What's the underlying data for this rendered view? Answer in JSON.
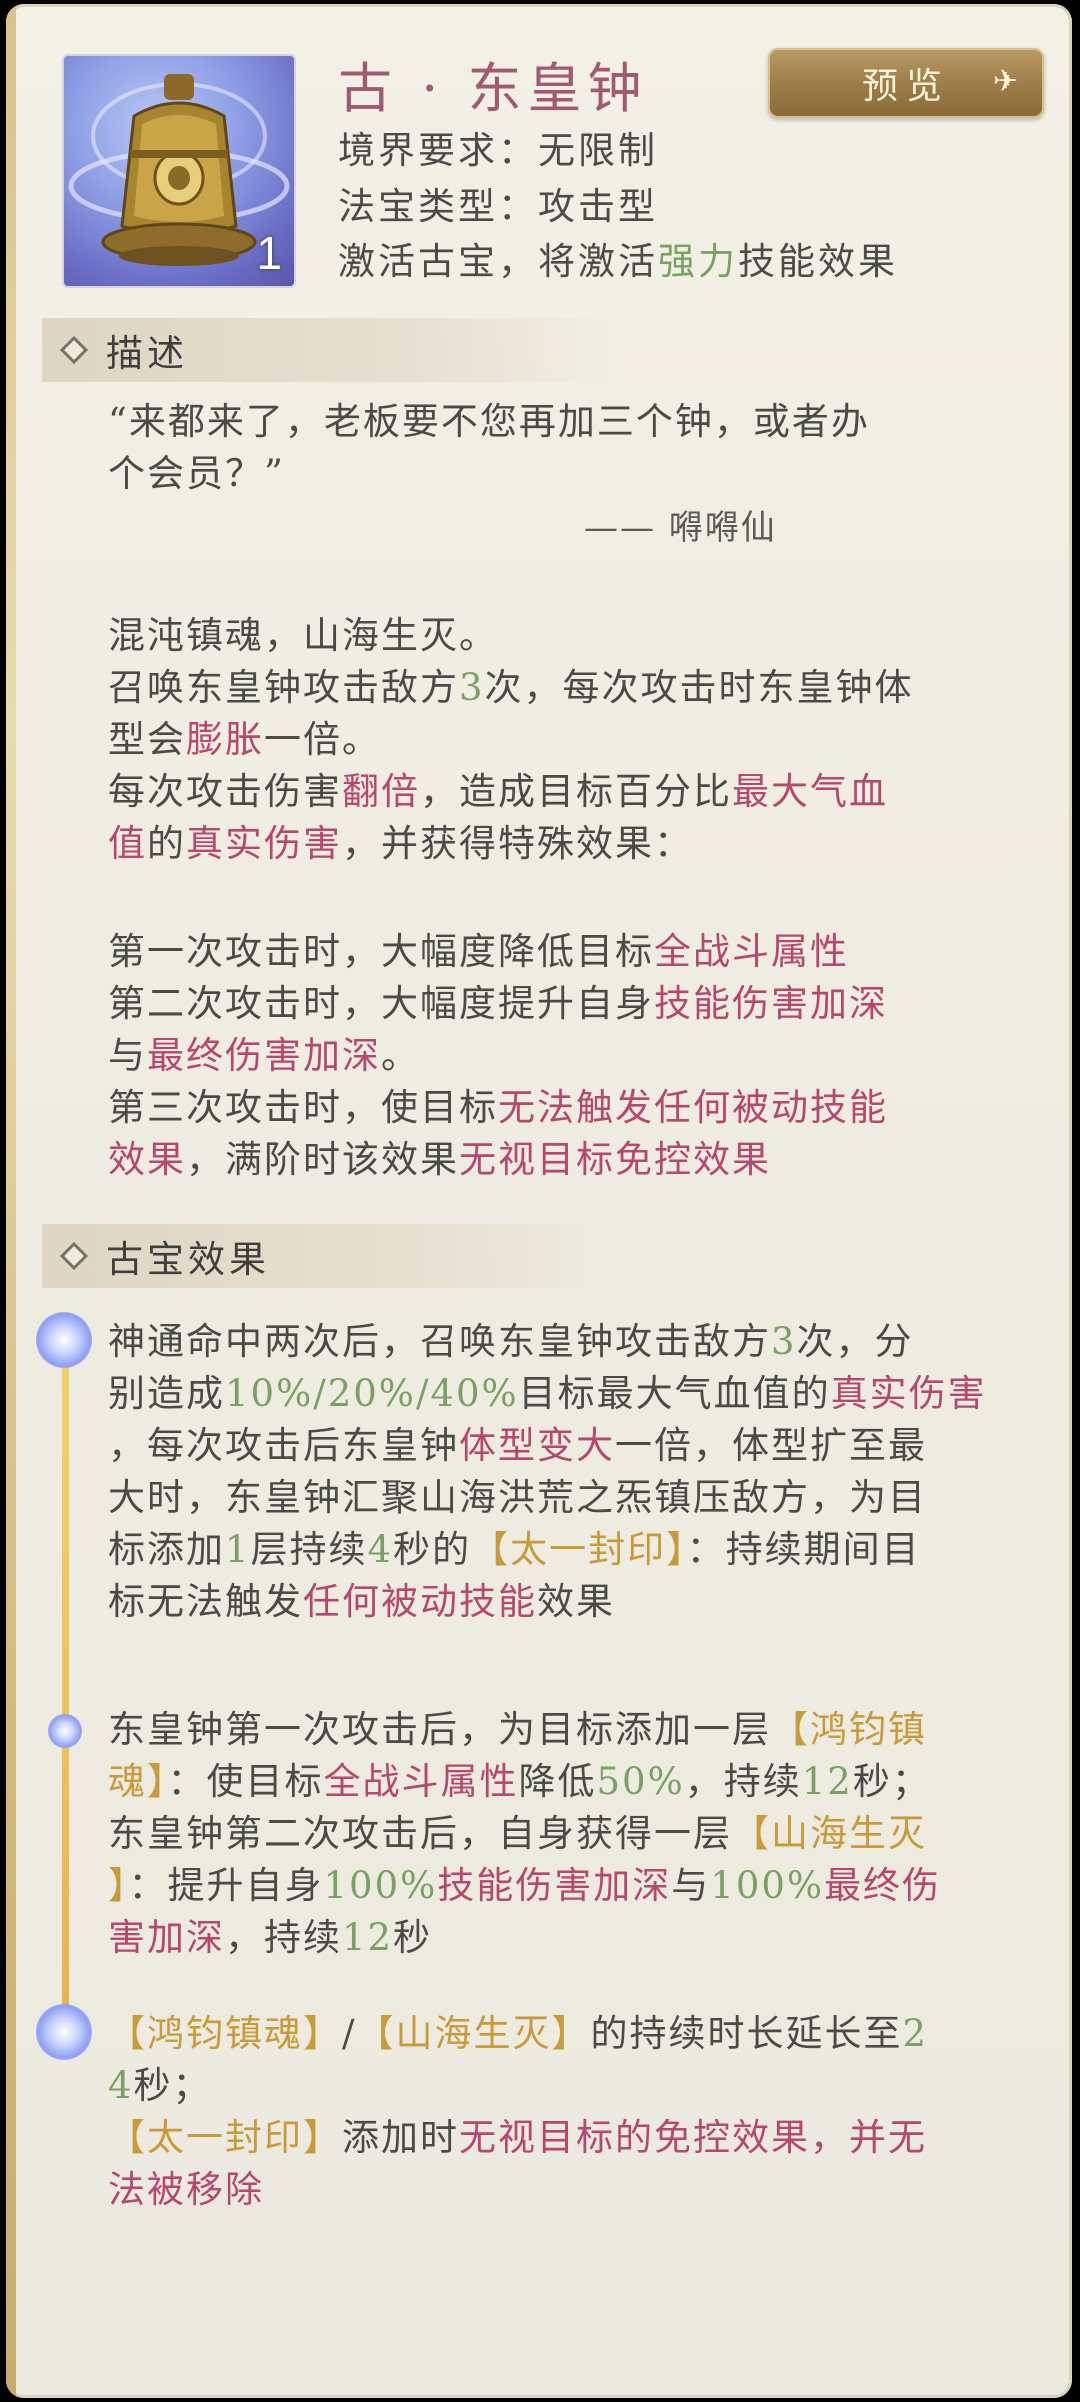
{
  "header": {
    "title": "古 · 东皇钟",
    "realm_requirement": "境界要求：无限制",
    "treasure_type": "法宝类型：攻击型",
    "activate_prefix": "激活古宝，将激活",
    "activate_highlight": "强力",
    "activate_suffix": "技能效果",
    "icon_level": "1",
    "preview_label": "预览",
    "icon": "golden-bell-icon"
  },
  "description": {
    "section_label": "描述",
    "quote_line1": "“来都来了，老板要不您再加三个钟，或者办",
    "quote_line2": "个会员？”",
    "author": "—— 嘚嘚仙",
    "p1": "混沌镇魂，山海生灭。",
    "p2_a": "召唤东皇钟攻击敌方",
    "p2_num": "3",
    "p2_b": "次，每次攻击时东皇钟体",
    "p2_c": "型会",
    "p2_hl": "膨胀",
    "p2_d": "一倍。",
    "p3_a": "每次攻击伤害",
    "p3_hl1": "翻倍",
    "p3_b": "，造成目标百分比",
    "p3_hl2": "最大气血",
    "p3_hl3": "值",
    "p3_c": "的",
    "p3_hl4": "真实伤害",
    "p3_d": "，并获得特殊效果：",
    "a1_a": "第一次攻击时，大幅度降低目标",
    "a1_hl": "全战斗属性",
    "a2_a": "第二次攻击时，大幅度提升自身",
    "a2_hl1": "技能伤害加深",
    "a2_b": "与",
    "a2_hl2": "最终伤害加深",
    "a2_c": "。",
    "a3_a": "第三次攻击时，使目标",
    "a3_hl1": "无法触发任何被动技能",
    "a3_hl2": "效果",
    "a3_b": "，满阶时该效果",
    "a3_hl3": "无视目标免控效果"
  },
  "treasure_effect": {
    "section_label": "古宝效果",
    "e1_a": "神通命中两次后，召唤东皇钟攻击敌方",
    "e1_num": "3",
    "e1_b": "次，分",
    "e1_c": "别造成",
    "e1_pct": "10%/20%/40%",
    "e1_d": "目标最大气血值的",
    "e1_hl1": "真实伤害",
    "e1_e": "，每次攻击后东皇钟",
    "e1_hl2": "体型变大",
    "e1_f": "一倍，体型扩至最",
    "e1_g": "大时，东皇钟汇聚山海洪荒之炁镇压敌方，为目",
    "e1_h": "标添加",
    "e1_num2": "1",
    "e1_i": "层持续",
    "e1_num3": "4",
    "e1_j": "秒的",
    "e1_tag": "【太一封印】",
    "e1_k": "：持续期间目",
    "e1_l": "标无法触发",
    "e1_hl3": "任何被动技能",
    "e1_m": "效果",
    "e2_a": "东皇钟第一次攻击后，为目标添加一层",
    "e2_tag1a": "【鸿钧镇",
    "e2_tag1b": "魂】",
    "e2_b": "：使目标",
    "e2_hl1": "全战斗属性",
    "e2_c": "降低",
    "e2_pct1": "50%",
    "e2_d": "，持续",
    "e2_num1": "12",
    "e2_e": "秒；",
    "e2_f": "东皇钟第二次攻击后，自身获得一层",
    "e2_tag2a": "【山海生灭",
    "e2_tag2b": "】",
    "e2_g": "：提升自身",
    "e2_pct2": "100%",
    "e2_hl2": "技能伤害加深",
    "e2_h": "与",
    "e2_pct3": "100%",
    "e2_hl3": "最终伤",
    "e2_hl4": "害加深",
    "e2_i": "，持续",
    "e2_num2": "12",
    "e2_j": "秒",
    "e3_tag1": "【鸿钧镇魂】",
    "e3_slash": "/",
    "e3_tag2": "【山海生灭】",
    "e3_a": "的持续时长延长至",
    "e3_num1": "2",
    "e3_num2": "4",
    "e3_b": "秒；",
    "e3_tag3": "【太一封印】",
    "e3_c": "添加时",
    "e3_hl1": "无视目标的免控效果，并无",
    "e3_hl2": "法被移除"
  },
  "colors": {
    "highlight_red": "#b4486f",
    "highlight_green": "#7aa064",
    "highlight_gold": "#c79a3a",
    "title_color": "#a05a72",
    "text_color": "#4a4a47"
  }
}
